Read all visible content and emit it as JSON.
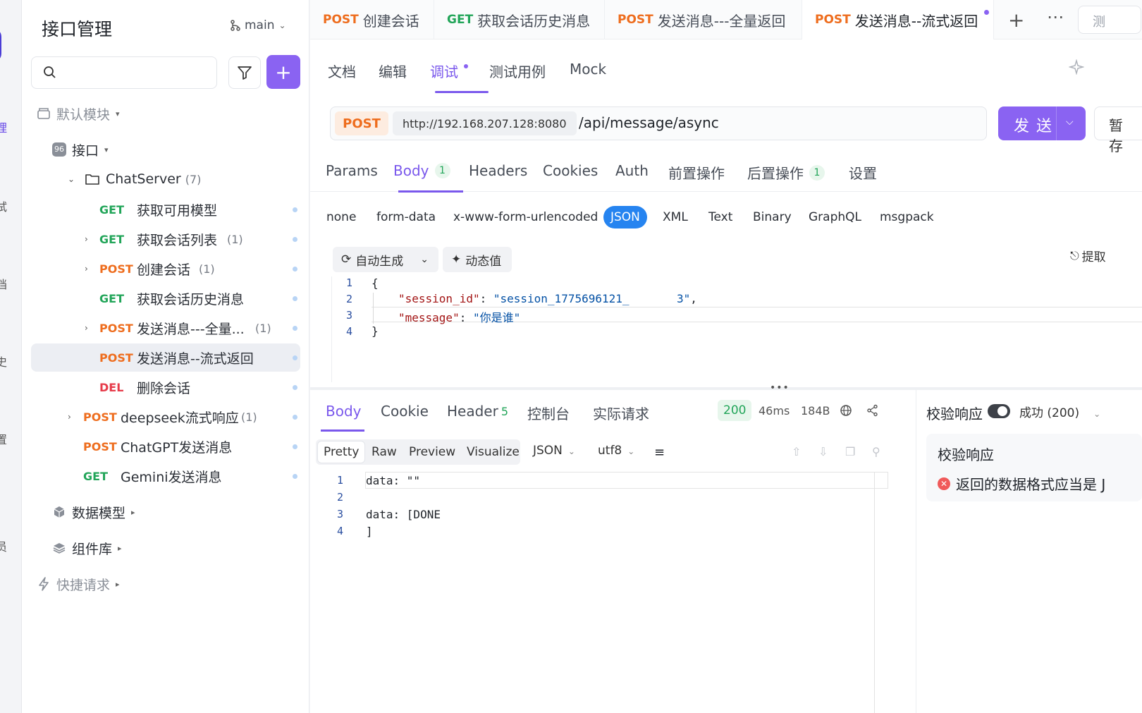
{
  "appnav": {
    "items": [
      "理",
      "试",
      "档",
      "史",
      "置",
      "员"
    ]
  },
  "sidebar": {
    "title": "接口管理",
    "branch": "main",
    "search_placeholder": "",
    "default_module": "默认模块",
    "interface_group": "接口",
    "folder": {
      "name": "ChatServer",
      "count": "(7)"
    },
    "items": [
      {
        "method": "GET",
        "name": "获取可用模型",
        "count": ""
      },
      {
        "method": "GET",
        "name": "获取会话列表",
        "count": "(1)"
      },
      {
        "method": "POST",
        "name": "创建会话",
        "count": "(1)"
      },
      {
        "method": "GET",
        "name": "获取会话历史消息",
        "count": ""
      },
      {
        "method": "POST",
        "name": "发送消息---全量...",
        "count": "(1)"
      },
      {
        "method": "POST",
        "name": "发送消息--流式返回",
        "count": ""
      },
      {
        "method": "DEL",
        "name": "删除会话",
        "count": ""
      },
      {
        "method": "POST",
        "name": "deepseek流式响应",
        "count": "(1)"
      },
      {
        "method": "POST",
        "name": "ChatGPT发送消息",
        "count": ""
      },
      {
        "method": "GET",
        "name": "Gemini发送消息",
        "count": ""
      }
    ],
    "data_model": "数据模型",
    "components": "组件库",
    "quick_request": "快捷请求"
  },
  "tabs": [
    {
      "method": "POST",
      "name": "创建会话"
    },
    {
      "method": "GET",
      "name": "获取会话历史消息"
    },
    {
      "method": "POST",
      "name": "发送消息---全量返回"
    },
    {
      "method": "POST",
      "name": "发送消息--流式返回"
    }
  ],
  "tab_overflow_label": "测",
  "subtabs": [
    "文档",
    "编辑",
    "调试",
    "测试用例",
    "Mock"
  ],
  "request": {
    "method": "POST",
    "host": "http://192.168.207.128:8080",
    "path": "/api/message/async",
    "send_label": "发送",
    "save_label": "暂存"
  },
  "req_tabs": [
    {
      "label": "Params",
      "badge": ""
    },
    {
      "label": "Body",
      "badge": "1"
    },
    {
      "label": "Headers",
      "badge": ""
    },
    {
      "label": "Cookies",
      "badge": ""
    },
    {
      "label": "Auth",
      "badge": ""
    },
    {
      "label": "前置操作",
      "badge": ""
    },
    {
      "label": "后置操作",
      "badge": "1"
    },
    {
      "label": "设置",
      "badge": ""
    }
  ],
  "body_types": [
    "none",
    "form-data",
    "x-www-form-urlencoded",
    "JSON",
    "XML",
    "Text",
    "Binary",
    "GraphQL",
    "msgpack"
  ],
  "editor": {
    "auto_generate": "自动生成",
    "dynamic_value": "动态值",
    "extract": "提取",
    "lines": [
      "1",
      "2",
      "3",
      "4"
    ],
    "open_brace": "{",
    "close_brace": "}",
    "key1": "\"session_id\"",
    "val1": "\"session_1775696121_       3\"",
    "key2": "\"message\"",
    "val2": "\"你是谁\""
  },
  "response": {
    "tabs": [
      "Body",
      "Cookie",
      "Header",
      "控制台",
      "实际请求"
    ],
    "header_count": "5",
    "status": "200",
    "time": "46ms",
    "size": "184B",
    "view_modes": [
      "Pretty",
      "Raw",
      "Preview",
      "Visualize"
    ],
    "format": "JSON",
    "encoding": "utf8",
    "lines": [
      "1",
      "2",
      "3",
      "4"
    ],
    "code": [
      "data: \"\"",
      "",
      "data: [DONE",
      "]"
    ]
  },
  "validation": {
    "title": "校验响应",
    "status": "成功 (200)",
    "card_title": "校验响应",
    "error": "返回的数据格式应当是 J"
  }
}
